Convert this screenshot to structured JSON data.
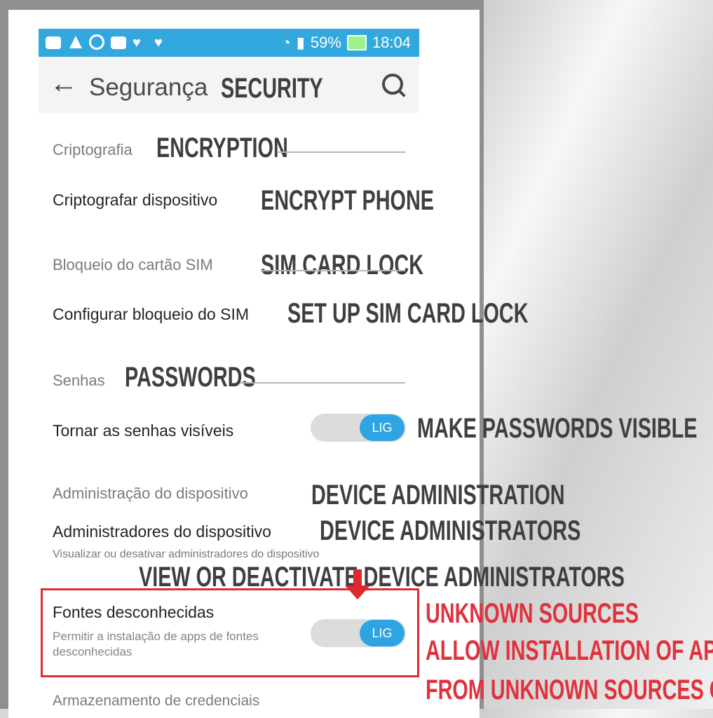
{
  "status_bar": {
    "battery": "59%",
    "time": "18:04",
    "icons": [
      "message-icon",
      "notification-icon",
      "whatsapp-icon",
      "gallery-icon",
      "twitter-icon",
      "twitter-icon",
      "wifi-icon",
      "signal-icon"
    ]
  },
  "header": {
    "back_icon": "back-arrow-icon",
    "title": "Segurança",
    "title_overlay": "SECURITY",
    "search_icon": "search-icon"
  },
  "sections": [
    {
      "title": "Criptografia",
      "overlay": "ENCRYPTION"
    },
    {
      "title": "Bloqueio do cartão SIM",
      "overlay": "SIM CARD LOCK"
    },
    {
      "title": "Senhas",
      "overlay": "PASSWORDS"
    },
    {
      "title": "Administração do dispositivo",
      "overlay": "DEVICE ADMINISTRATION"
    }
  ],
  "items": [
    {
      "title": "Criptografar dispositivo",
      "overlay": "ENCRYPT PHONE"
    },
    {
      "title": "Configurar bloqueio do SIM",
      "overlay": "SET UP SIM CARD LOCK"
    },
    {
      "title": "Tornar as senhas visíveis",
      "overlay": "MAKE PASSWORDS VISIBLE",
      "toggle": "LIG"
    },
    {
      "title": "Administradores do dispositivo",
      "overlay": "DEVICE ADMINISTRATORS",
      "subtitle": "Visualizar ou desativar administradores do dispositivo",
      "subtitle_overlay": "VIEW OR DEACTIVATE DEVICE ADMINISTRATORS"
    },
    {
      "title": "Fontes desconhecidas",
      "subtitle": "Permitir a instalação de apps de fontes desconhecidas",
      "toggle": "LIG",
      "overlay_lines": [
        "UNKNOWN SOURCES",
        "ALLOW INSTALLATION OF APPS",
        "FROM UNKNOWN SOURCES ON"
      ]
    },
    {
      "title": "Armazenamento de credenciais"
    }
  ],
  "colors": {
    "status_bar": "#33a8df",
    "toggle_on": "#2ea4e3",
    "highlight": "#db2b37",
    "overlay_dark": "#3f3f3f",
    "overlay_red": "#e0323d"
  }
}
